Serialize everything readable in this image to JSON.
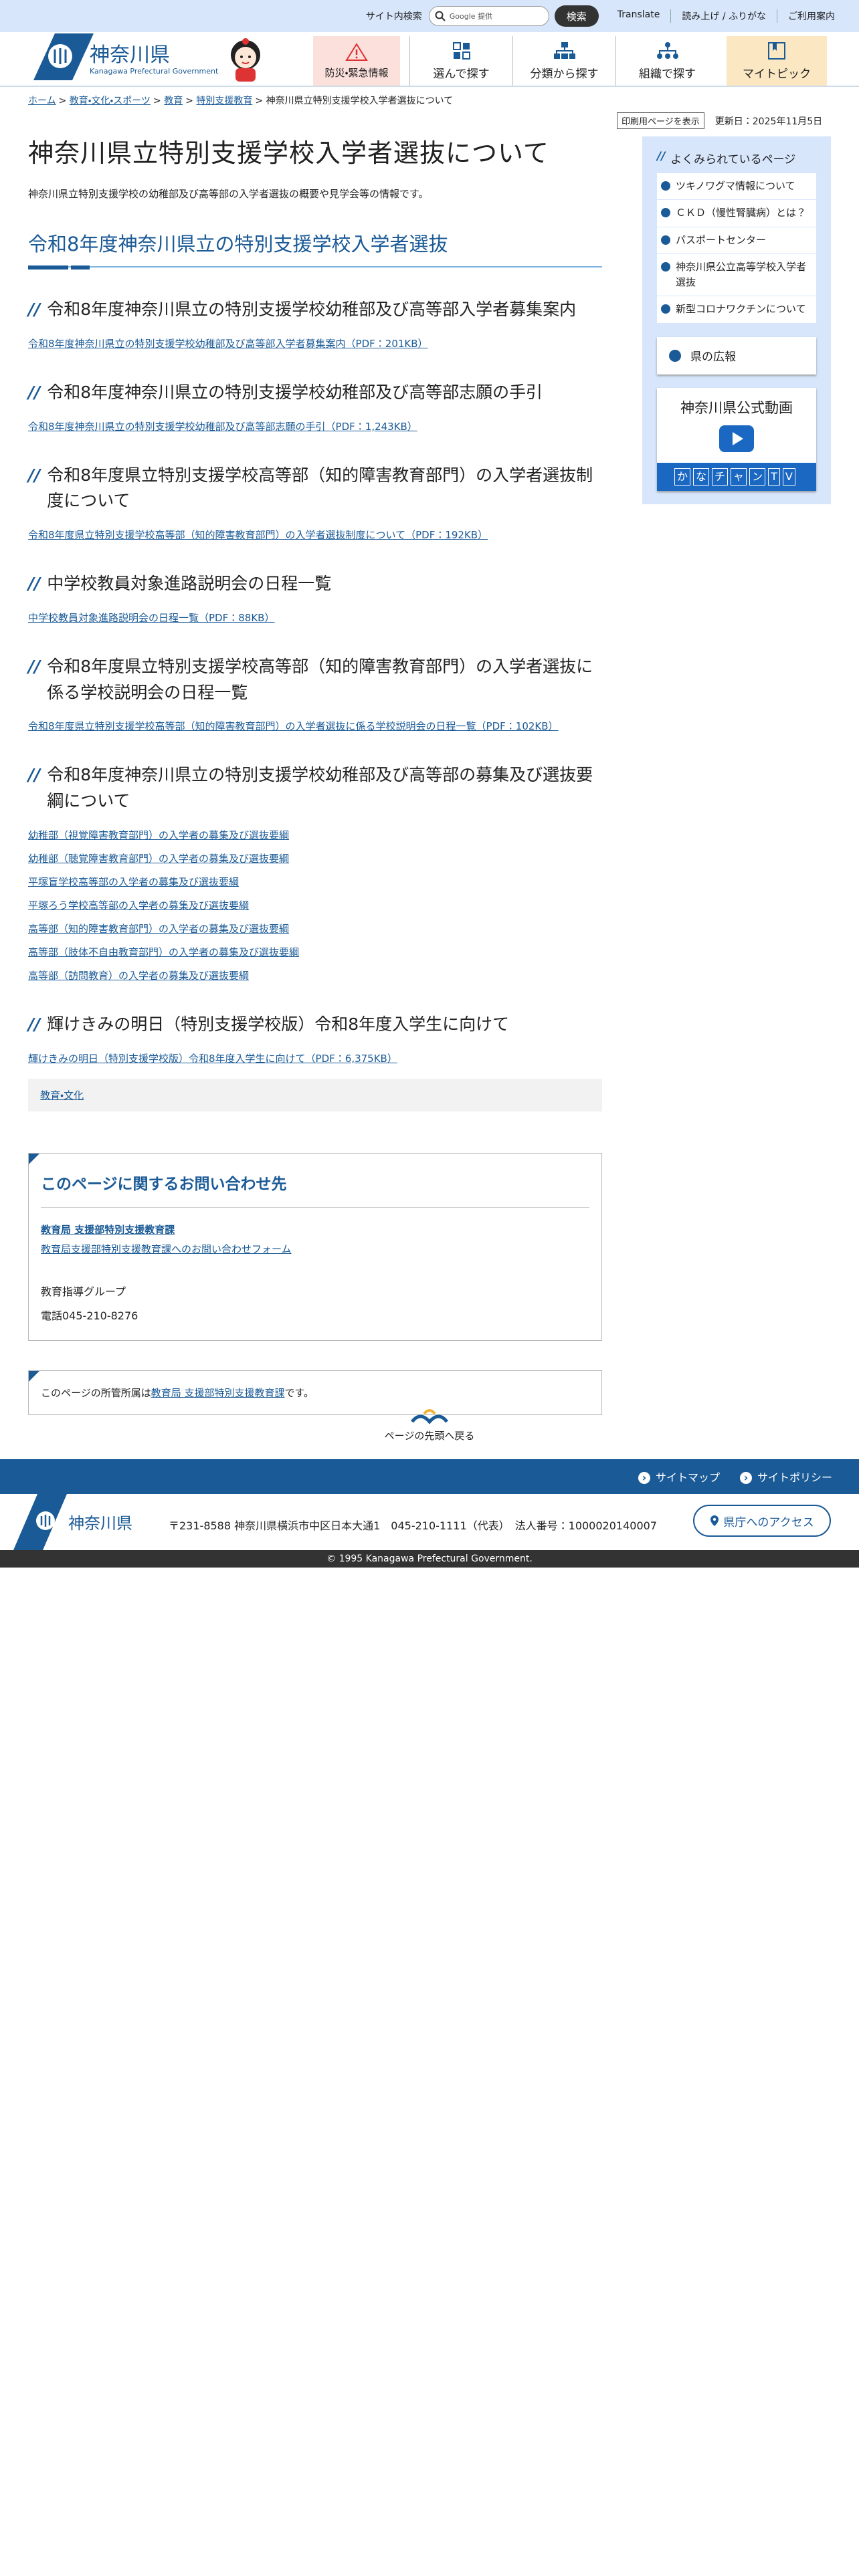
{
  "colors": {
    "accent": "#1a5a96",
    "topbar": "#d7e6fb",
    "bousai": "#fbe0dc",
    "mytopic": "#fbe8c2"
  },
  "topbar": {
    "search_label": "サイト内検索",
    "search_placeholder": "Google 提供",
    "search_button": "検索",
    "links": [
      "Translate",
      "読み上げ / ふりがな",
      "ご利用案内"
    ]
  },
  "header": {
    "logo_name": "神奈川県",
    "logo_sub": "Kanagawa Prefectural Government",
    "nav": [
      {
        "label": "防災・緊急情報",
        "icon": "warning-icon"
      },
      {
        "label": "選んで探す",
        "icon": "grid-icon"
      },
      {
        "label": "分類から探す",
        "icon": "sitemap-icon"
      },
      {
        "label": "組織で探す",
        "icon": "org-icon"
      },
      {
        "label": "マイトピック",
        "icon": "bookmark-icon"
      }
    ]
  },
  "breadcrumb": [
    "ホーム",
    "教育・文化・スポーツ",
    "教育",
    "特別支援教育",
    "神奈川県立特別支援学校入学者選抜について"
  ],
  "meta": {
    "print": "印刷用ページを表示",
    "updated": "更新日：2025年11月5日"
  },
  "page": {
    "title": "神奈川県立特別支援学校入学者選抜について",
    "lead": "神奈川県立特別支援学校の幼稚部及び高等部の入学者選抜の概要や見学会等の情報です。",
    "h2": "令和8年度神奈川県立の特別支援学校入学者選抜"
  },
  "sections": [
    {
      "heading": "令和8年度神奈川県立の特別支援学校幼稚部及び高等部入学者募集案内",
      "links": [
        "令和8年度神奈川県立の特別支援学校幼稚部及び高等部入学者募集案内（PDF：201KB）"
      ]
    },
    {
      "heading": "令和8年度神奈川県立の特別支援学校幼稚部及び高等部志願の手引",
      "links": [
        "令和8年度神奈川県立の特別支援学校幼稚部及び高等部志願の手引（PDF：1,243KB）"
      ]
    },
    {
      "heading": "令和8年度県立特別支援学校高等部（知的障害教育部門）の入学者選抜制度について",
      "links": [
        "令和8年度県立特別支援学校高等部（知的障害教育部門）の入学者選抜制度について（PDF：192KB）"
      ]
    },
    {
      "heading": "中学校教員対象進路説明会の日程一覧",
      "links": [
        "中学校教員対象進路説明会の日程一覧（PDF：88KB）"
      ]
    },
    {
      "heading": "令和8年度県立特別支援学校高等部（知的障害教育部門）の入学者選抜に係る学校説明会の日程一覧",
      "links": [
        "令和8年度県立特別支援学校高等部（知的障害教育部門）の入学者選抜に係る学校説明会の日程一覧（PDF：102KB）"
      ]
    },
    {
      "heading": "令和8年度神奈川県立の特別支援学校幼稚部及び高等部の募集及び選抜要綱について",
      "links": [
        "幼稚部（視覚障害教育部門）の入学者の募集及び選抜要綱",
        "幼稚部（聴覚障害教育部門）の入学者の募集及び選抜要綱",
        "平塚盲学校高等部の入学者の募集及び選抜要綱",
        "平塚ろう学校高等部の入学者の募集及び選抜要綱",
        "高等部（知的障害教育部門）の入学者の募集及び選抜要綱",
        "高等部（肢体不自由教育部門）の入学者の募集及び選抜要綱",
        "高等部（訪問教育）の入学者の募集及び選抜要綱"
      ]
    },
    {
      "heading": "輝けきみの明日（特別支援学校版）令和8年度入学生に向けて",
      "links": [
        "輝けきみの明日（特別支援学校版）令和8年度入学生に向けて（PDF：6,375KB）"
      ]
    }
  ],
  "tag": "教育・文化",
  "contact": {
    "title": "このページに関するお問い合わせ先",
    "dept": "教育局 支援部特別支援教育課",
    "form": "教育局支援部特別支援教育課へのお問い合わせフォーム",
    "group": "教育指導グループ",
    "tel": "電話045-210-8276"
  },
  "owner": {
    "prefix": "このページの所管所属は",
    "dept": "教育局 支援部特別支援教育課",
    "suffix": "です。"
  },
  "sidebar": {
    "title": "よくみられているページ",
    "items": [
      "ツキノワグマ情報について",
      "ＣＫＤ（慢性腎臓病）とは？",
      "パスポートセンター",
      "神奈川県公立高等学校入学者選抜",
      "新型コロナワクチンについて"
    ],
    "koho": "県の広報",
    "video_title": "神奈川県公式動画",
    "video_chars": [
      "か",
      "な",
      "チ",
      "ャ",
      "ン",
      "T",
      "V"
    ]
  },
  "totop": "ページの先頭へ戻る",
  "footer": {
    "links": [
      "サイトマップ",
      "サイトポリシー"
    ],
    "name": "神奈川県",
    "address": "〒231-8588 神奈川県横浜市中区日本大通1　045-210-1111（代表）　法人番号：1000020140007",
    "access": "県庁へのアクセス",
    "copyright": "© 1995 Kanagawa Prefectural Government."
  }
}
